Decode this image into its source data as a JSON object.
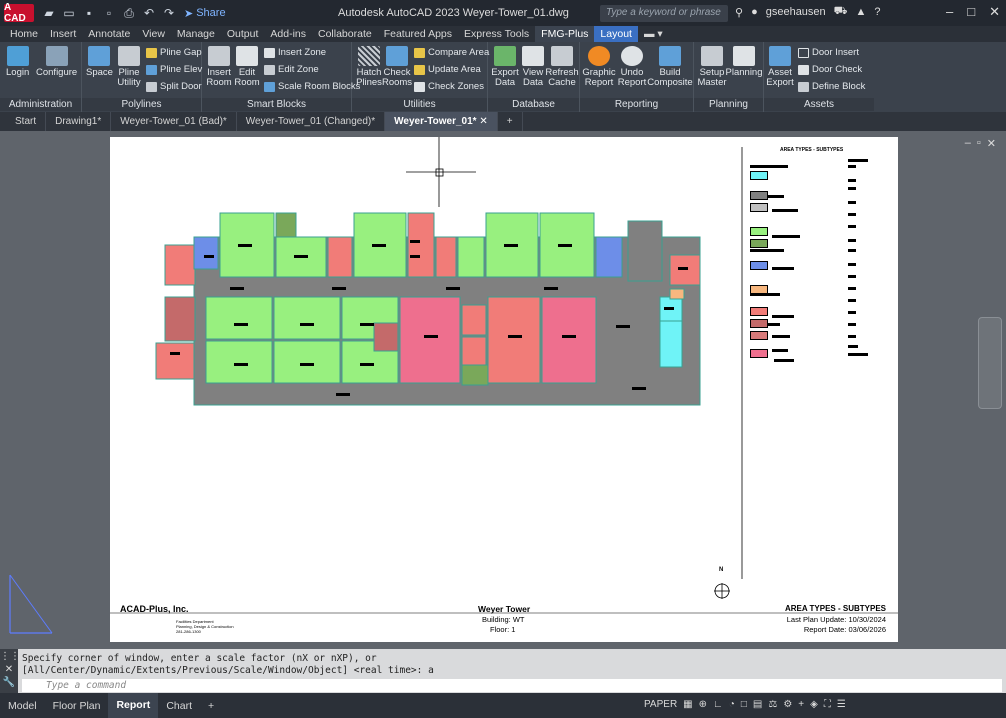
{
  "titlebar": {
    "logo": "A CAD",
    "share_label": "Share",
    "title": "Autodesk AutoCAD 2023   Weyer-Tower_01.dwg",
    "search_placeholder": "Type a keyword or phrase",
    "user": "gseehausen"
  },
  "ribbon_tabs": [
    "Home",
    "Insert",
    "Annotate",
    "View",
    "Manage",
    "Output",
    "Add-ins",
    "Collaborate",
    "Featured Apps",
    "Express Tools",
    "FMG-Plus",
    "Layout"
  ],
  "ribbon": {
    "groups": {
      "administration": "Administration",
      "polylines": "Polylines",
      "smart_blocks": "Smart Blocks",
      "utilities": "Utilities",
      "database": "Database",
      "reporting": "Reporting",
      "planning": "Planning",
      "assets": "Assets"
    },
    "buttons": {
      "login": "Login",
      "configure": "Configure",
      "space": "Space",
      "pline_utility": "Pline Utility",
      "pline_gap": "Pline Gap",
      "pline_elev": "Pline Elev",
      "split_door": "Split Door",
      "insert_room": "Insert Room",
      "edit_room": "Edit Room",
      "insert_zone": "Insert Zone",
      "edit_zone": "Edit Zone",
      "scale_room_blocks": "Scale Room Blocks",
      "hatch_plines": "Hatch Plines",
      "check_rooms": "Check Rooms",
      "compare_area": "Compare Area",
      "update_area": "Update Area",
      "check_zones": "Check Zones",
      "export_data": "Export Data",
      "view_data": "View Data",
      "refresh_cache": "Refresh Cache",
      "graphic_report": "Graphic Report",
      "undo_report": "Undo Report",
      "build_composite": "Build Composite",
      "setup_master": "Setup Master",
      "planning": "Planning",
      "asset_export": "Asset Export",
      "door_insert": "Door Insert",
      "door_check": "Door Check",
      "define_block": "Define Block"
    }
  },
  "file_tabs": [
    "Start",
    "Drawing1*",
    "Weyer-Tower_01 (Bad)*",
    "Weyer-Tower_01 (Changed)*",
    "Weyer-Tower_01*"
  ],
  "titleblock": {
    "company": "ACAD-Plus, Inc.",
    "dept_line1": "Facilities Department",
    "dept_line2": "Planning, Design & Construction",
    "dept_line3": "281-286-1300",
    "building_name": "Weyer Tower",
    "building": "Building: WT",
    "floor": "Floor: 1",
    "report_title": "AREA TYPES - SUBTYPES",
    "last_update": "Last Plan Update: 10/30/2024",
    "report_date": "Report Date: 03/06/2026",
    "north": "N"
  },
  "legend": {
    "title": "AREA TYPES - SUBTYPES",
    "swatches": [
      "#6ff3f7",
      "#808080",
      "#c0c0c0",
      "#98f07f",
      "#7aa85a",
      "#6d8ee8",
      "#f7b77f",
      "#f17c78",
      "#c46a6a",
      "#d87a7a",
      "#ee6f8e"
    ]
  },
  "colors": {
    "office_green": "#98f07f",
    "corridor_gray": "#808080",
    "red_room": "#f17c78",
    "pink_room": "#ee6f8e",
    "blue_room": "#6d8ee8",
    "cyan_room": "#6ff3f7",
    "orange_room": "#f7b77f"
  },
  "command": {
    "history_line1": "Specify corner of window, enter a scale factor (nX or nXP), or",
    "history_line2": "[All/Center/Dynamic/Extents/Previous/Scale/Window/Object] <real time>: a",
    "placeholder": "Type a command"
  },
  "layout_tabs": [
    "Model",
    "Floor Plan",
    "Report",
    "Chart"
  ],
  "status": {
    "paper": "PAPER"
  }
}
